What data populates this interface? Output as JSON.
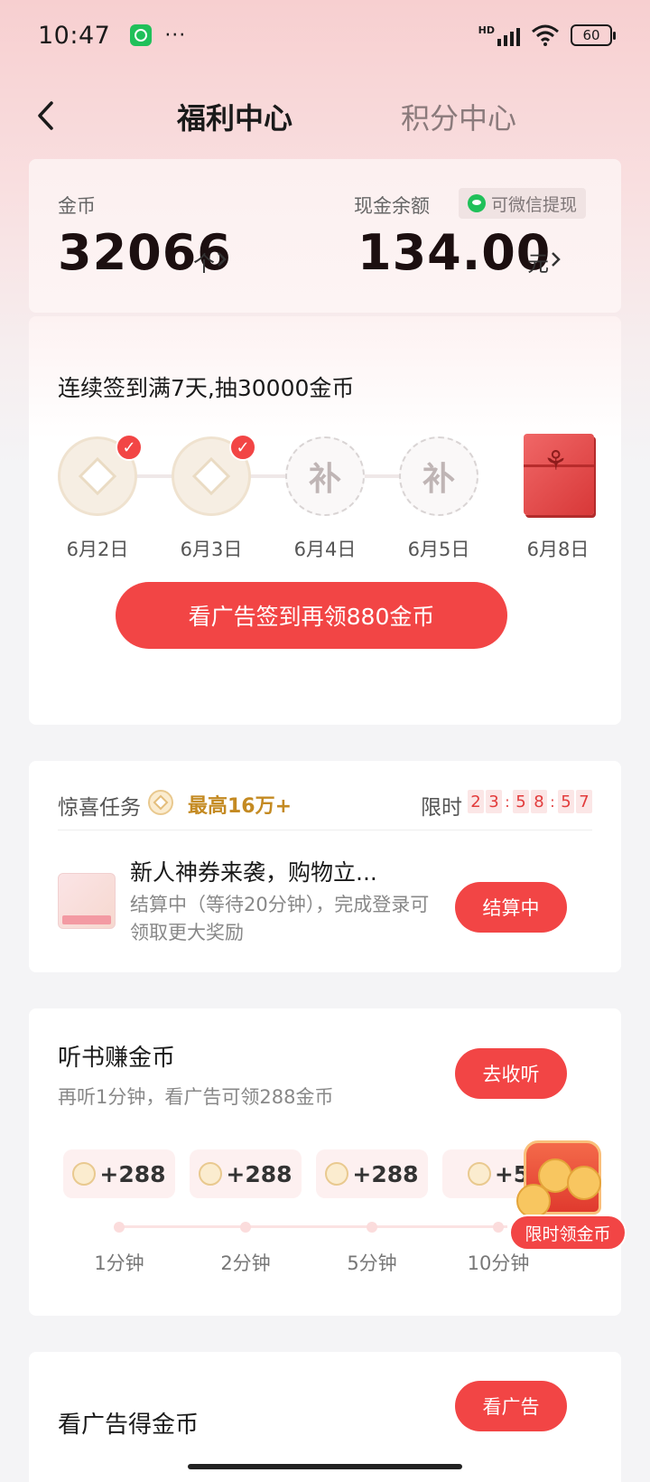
{
  "status_bar": {
    "time": "10:47",
    "dots": "···",
    "network": "HD",
    "battery": "60"
  },
  "nav": {
    "back_icon": "chevron-left-icon",
    "tab_active": "福利中心",
    "tab_inactive": "积分中心"
  },
  "balance": {
    "coins_label": "金币",
    "coins_value": "32066",
    "coins_unit": "个",
    "cash_label": "现金余额",
    "wechat_badge": "可微信提现",
    "cash_value": "134.00",
    "cash_unit": "元"
  },
  "signin": {
    "title": "连续签到满7天,抽30000金币",
    "makeup_char": "补",
    "days": [
      {
        "label": "6月2日",
        "state": "checked"
      },
      {
        "label": "6月3日",
        "state": "checked"
      },
      {
        "label": "6月4日",
        "state": "makeup"
      },
      {
        "label": "6月5日",
        "state": "makeup"
      },
      {
        "label": "6月8日",
        "state": "gift"
      }
    ],
    "button": "看广告签到再领880金币"
  },
  "surprise_task": {
    "title": "惊喜任务",
    "max": "最高16万+",
    "limit_label": "限时",
    "timer": [
      "2",
      "3",
      "5",
      "8",
      "5",
      "7"
    ],
    "item_title": "新人神券来袭，购物立...",
    "item_desc": "结算中（等待20分钟），完成登录可领取更大奖励",
    "item_button": "结算中"
  },
  "audio": {
    "title": "听书赚金币",
    "subtitle": "再听1分钟，看广告可领288金币",
    "button": "去收听",
    "rewards": [
      {
        "amount": "+288",
        "time": "1分钟"
      },
      {
        "amount": "+288",
        "time": "2分钟"
      },
      {
        "amount": "+288",
        "time": "5分钟"
      },
      {
        "amount": "+5",
        "time": "10分钟"
      }
    ]
  },
  "promo": {
    "label": "限时领金币"
  },
  "ad": {
    "title": "看广告得金币",
    "button": "看广告"
  },
  "colors": {
    "accent": "#f24545",
    "gold": "#c48a22",
    "wechat": "#20c05a"
  }
}
